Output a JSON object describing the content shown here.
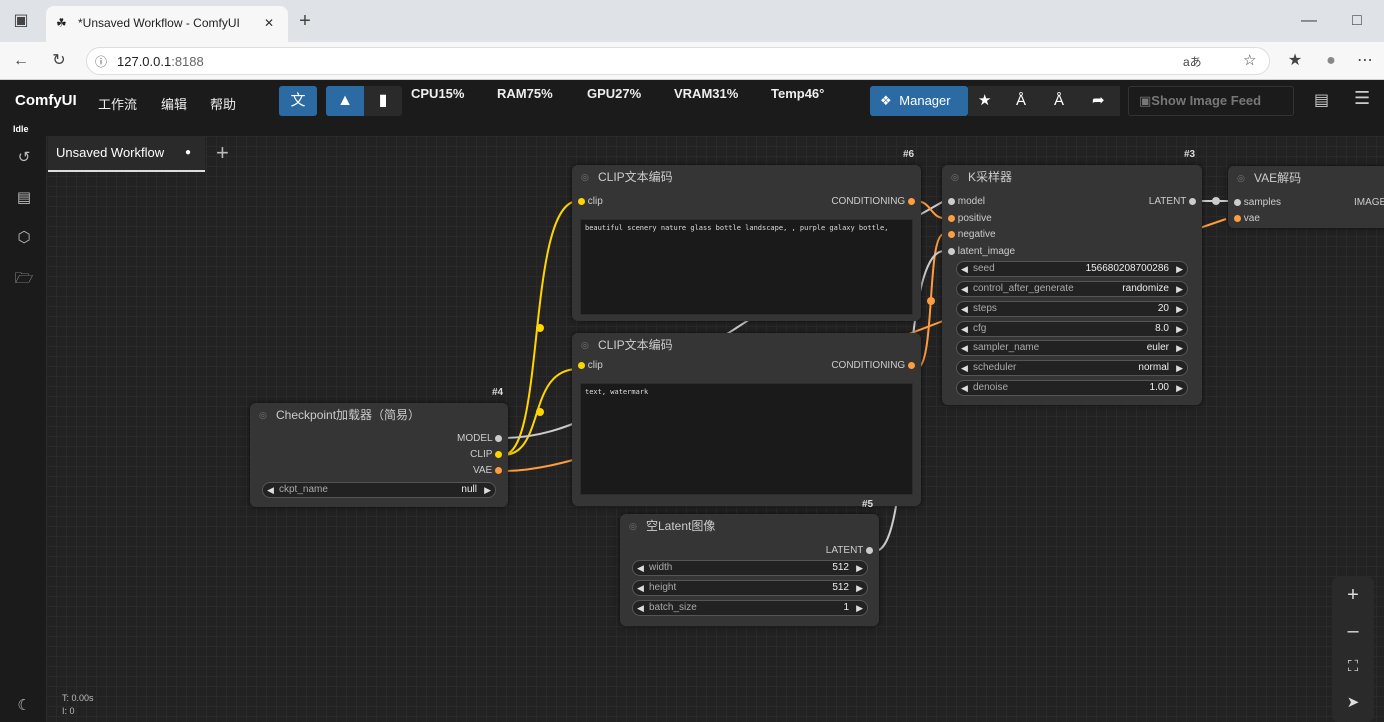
{
  "browser": {
    "tab_title": "*Unsaved Workflow - ComfyUI",
    "url_host": "127.0.0.1",
    "url_port": ":8188",
    "new_tab": "+",
    "close": "✕"
  },
  "menu": {
    "logo": "ComfyUI",
    "items": [
      "工作流",
      "编辑",
      "帮助"
    ]
  },
  "stats": {
    "cpu": "CPU15%",
    "ram": "RAM75%",
    "gpu": "GPU27%",
    "vram": "VRAM31%",
    "temp": "Temp46°"
  },
  "toolbar": {
    "manager": "Manager",
    "feed": "Show Image Feed"
  },
  "status": "Idle",
  "workflow_tab": {
    "label": "Unsaved Workflow",
    "add": "+"
  },
  "nodes": {
    "clip1": {
      "id": "#6",
      "title": "CLIP文本编码",
      "in": "clip",
      "out": "CONDITIONING",
      "text": "beautiful scenery nature glass bottle landscape, , purple galaxy bottle,"
    },
    "clip2": {
      "id": "",
      "title": "CLIP文本编码",
      "in": "clip",
      "out": "CONDITIONING",
      "text": "text, watermark"
    },
    "ksampler": {
      "id": "#3",
      "title": "K采样器",
      "inputs": [
        "model",
        "positive",
        "negative",
        "latent_image"
      ],
      "out": "LATENT",
      "widgets": [
        {
          "l": "seed",
          "v": "156680208700286"
        },
        {
          "l": "control_after_generate",
          "v": "randomize"
        },
        {
          "l": "steps",
          "v": "20"
        },
        {
          "l": "cfg",
          "v": "8.0"
        },
        {
          "l": "sampler_name",
          "v": "euler"
        },
        {
          "l": "scheduler",
          "v": "normal"
        },
        {
          "l": "denoise",
          "v": "1.00"
        }
      ]
    },
    "vae": {
      "title": "VAE解码",
      "inputs": [
        "samples",
        "vae"
      ],
      "out": "IMAGE"
    },
    "ckpt": {
      "id": "#4",
      "title": "Checkpoint加载器（简易）",
      "outs": [
        "MODEL",
        "CLIP",
        "VAE"
      ],
      "widget": {
        "l": "ckpt_name",
        "v": "null"
      }
    },
    "latent": {
      "id": "#5",
      "title": "空Latent图像",
      "out": "LATENT",
      "widgets": [
        {
          "l": "width",
          "v": "512"
        },
        {
          "l": "height",
          "v": "512"
        },
        {
          "l": "batch_size",
          "v": "1"
        }
      ]
    }
  },
  "stats_overlay": {
    "t": "T: 0.00s",
    "i": "I: 0"
  },
  "colors": {
    "clip": "#ffd500",
    "vae": "#ff9c3d",
    "model": "#cccccc",
    "accent": "#2b6aa3"
  }
}
